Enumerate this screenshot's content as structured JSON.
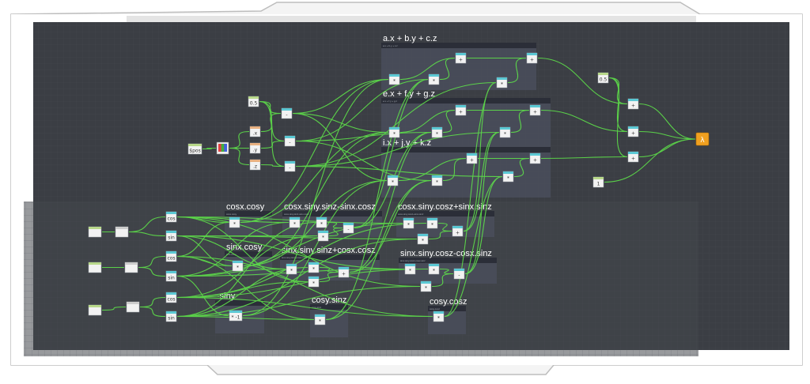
{
  "colors": {
    "canvas": "#3b3e44",
    "canvas_lower": "#44474d",
    "frame_border": "#c8c8c8",
    "group_bg": "#4a4e5c",
    "group_bar": "#2b2e38",
    "wire": "#5ee04a",
    "node_head": "#5bc8d4",
    "input_head": "#b8d88a",
    "vec_head": "#e8b080",
    "output": "#f0a020"
  },
  "groups": [
    {
      "title": "a.x + b.y + c.z",
      "subtitle": "a.x + b.y + c.z"
    },
    {
      "title": "e.x + f.y + g.z",
      "subtitle": "e.x + f.y + g.z"
    },
    {
      "title": "i.x + j.y + k.z",
      "subtitle": ""
    },
    {
      "title": "cosx.cosy",
      "subtitle": "cosx.cosy"
    },
    {
      "title": "cosx.siny.sinz-sinx.cosz",
      "subtitle": "cosx.siny.sinz-sinx.cosz"
    },
    {
      "title": "cosx.siny.cosz+sinx.sinz",
      "subtitle": "cosx.siny.cosz+sinx.sinz"
    },
    {
      "title": "sinx.cosy",
      "subtitle": "sinx.cosy"
    },
    {
      "title": "sinx.siny.sinz+cosx.cosz",
      "subtitle": "sinx.siny.sinz+cosx.cosz"
    },
    {
      "title": "sinx.siny.cosz-cosx.sinz",
      "subtitle": "sinx.siny.cosz-cosx.sinz"
    },
    {
      "title": "-siny",
      "subtitle": ""
    },
    {
      "title": "cosy.sinz",
      "subtitle": "cosy.sinz"
    },
    {
      "title": "cosy.cosz",
      "subtitle": "cosy.cosz"
    }
  ],
  "nodes": {
    "spos": "$pos",
    "const_half_a": "0.5",
    "const_half_b": "0.5",
    "const_one": "1",
    "split_x": ".x",
    "split_y": ".y",
    "split_z": ".z",
    "minus": "-",
    "multiply": "*",
    "add": "+",
    "negate_mul": "* -1",
    "output_icon": "vex-output-icon"
  }
}
